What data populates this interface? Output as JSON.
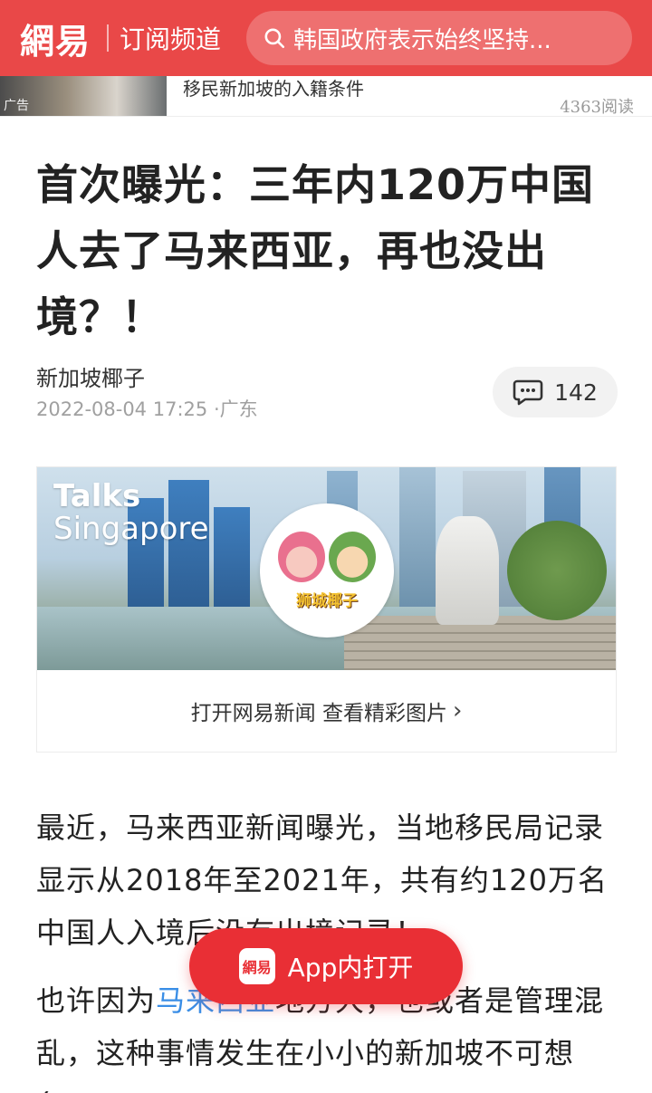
{
  "header": {
    "logo": "網易",
    "channel": "订阅频道",
    "search_text": "韩国政府表示始终坚持..."
  },
  "ad": {
    "label": "广告",
    "title": "移民新加坡的入籍条件",
    "reads": "4363阅读"
  },
  "article": {
    "title": "首次曝光：三年内120万中国人去了马来西亚，再也没出境？！",
    "author": "新加坡椰子",
    "datetime": "2022-08-04 17:25",
    "location": "·广东",
    "comment_count": "142"
  },
  "image_card": {
    "overlay_line1": "Talks",
    "overlay_line2": "Singapore",
    "badge_text": "狮城椰子",
    "cta": "打开网易新闻 查看精彩图片"
  },
  "body": {
    "p1": "最近，马来西亚新闻曝光，当地移民局记录显示从2018年至2021年，共有约120万名中国人入境后没有出境记录！",
    "p2_before": "也许因为",
    "p2_link": "马来西亚",
    "p2_after": "地方大，也或者是管理混乱，这种事情发生在小小的新加坡不可想象。"
  },
  "open_app": {
    "logo": "網易",
    "label": "App内打开"
  },
  "colors": {
    "brand_red": "#e94848",
    "button_red": "#e92f35",
    "link_blue": "#3a8ee6"
  }
}
